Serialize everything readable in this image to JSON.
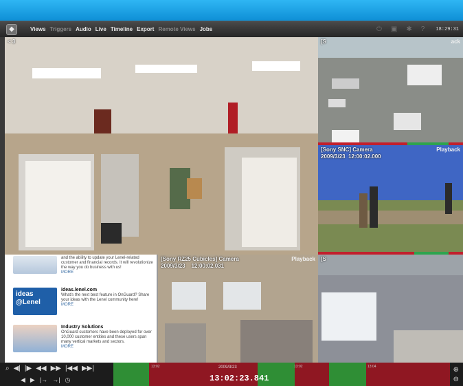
{
  "menu": {
    "items": [
      {
        "label": "Views",
        "dim": false
      },
      {
        "label": "Triggers",
        "dim": true
      },
      {
        "label": "Audio",
        "dim": false
      },
      {
        "label": "Live",
        "dim": false
      },
      {
        "label": "Timeline",
        "dim": false
      },
      {
        "label": "Export",
        "dim": false
      },
      {
        "label": "Remote Views",
        "dim": true
      },
      {
        "label": "Jobs",
        "dim": false
      }
    ],
    "clock": "18:29:31"
  },
  "tiles": {
    "main": {
      "label": "< 3"
    },
    "parking": {
      "label": "[S",
      "playback": "ack"
    },
    "sony_cam": {
      "label": "[Sony SNC] Camera\n2009/3/23  12:00:02.000",
      "playback": "Playback"
    },
    "cubicles": {
      "label": "[Sony RZ25 Cubicles] Camera\n2009/3/23    12:00:02.031",
      "playback": "Playback"
    },
    "lot": {
      "label": "[S"
    }
  },
  "browser": {
    "items": [
      {
        "title": "",
        "text": "and the ability to update your Lenel-related customer and financial records. It will revolutionize the way you do business with us!",
        "more": "MORE"
      },
      {
        "title": "ideas.lenel.com",
        "text": "What's the next best feature in OnGuard? Share your ideas with the Lenel community here!",
        "more": "MORE",
        "thumb": "ideas @Lenel"
      },
      {
        "title": "Industry Solutions",
        "text": "OnGuard customers have been deployed for over 10,000 customer entities and these users span many vertical markets and sectors.",
        "more": "MORE"
      }
    ]
  },
  "timeline": {
    "time": "13:02:23.841",
    "date": "2009/3/23",
    "ticks": [
      "13:02",
      "13:02",
      "13:04"
    ],
    "controls": [
      "magnify-icon",
      "step-back-icon",
      "step-forward-icon",
      "rewind-icon",
      "fast-forward-icon",
      "skip-start-icon",
      "skip-end-icon"
    ],
    "controls2": [
      "prev-icon",
      "next-icon",
      "range-start-icon",
      "range-end-icon",
      "clock-icon"
    ]
  }
}
